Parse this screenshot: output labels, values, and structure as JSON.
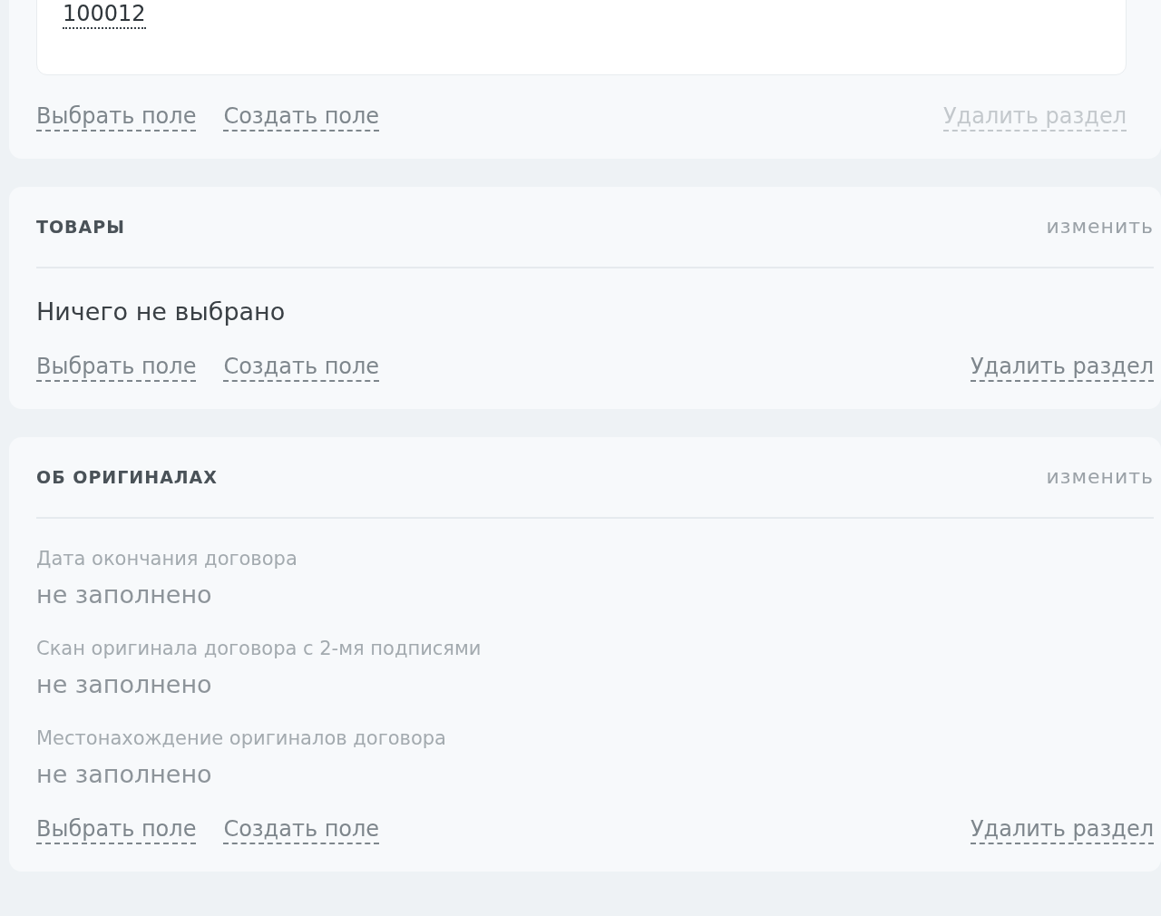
{
  "sections": [
    {
      "value": "100012",
      "links": {
        "select": "Выбрать поле",
        "create": "Создать поле",
        "delete": "Удалить раздел",
        "delete_disabled": true
      }
    },
    {
      "title": "ТОВАРЫ",
      "edit": "изменить",
      "empty_text": "Ничего не выбрано",
      "links": {
        "select": "Выбрать поле",
        "create": "Создать поле",
        "delete": "Удалить раздел",
        "delete_disabled": false
      }
    },
    {
      "title": "ОБ ОРИГИНАЛАХ",
      "edit": "изменить",
      "fields": [
        {
          "label": "Дата окончания договора",
          "value": "не заполнено"
        },
        {
          "label": "Скан оригинала договора с 2-мя подписями",
          "value": "не заполнено"
        },
        {
          "label": "Местонахождение оригиналов договора",
          "value": "не заполнено"
        }
      ],
      "links": {
        "select": "Выбрать поле",
        "create": "Создать поле",
        "delete": "Удалить раздел",
        "delete_disabled": false
      }
    }
  ]
}
